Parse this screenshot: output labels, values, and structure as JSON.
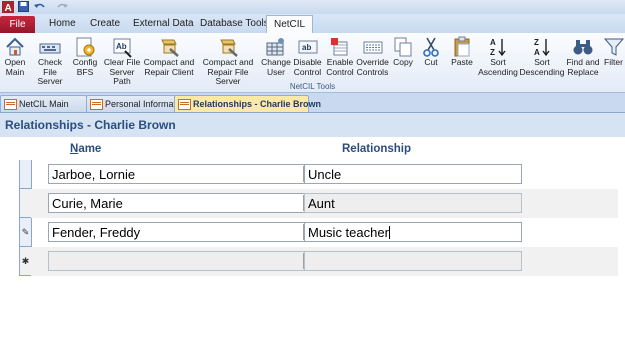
{
  "quick_access": {
    "app_icon": "access-icon",
    "save_icon": "save-icon",
    "undo_icon": "undo-icon",
    "redo_icon": "redo-icon"
  },
  "ribbon_tabs": [
    "File",
    "Home",
    "Create",
    "External Data",
    "Database Tools",
    "NetCIL"
  ],
  "active_ribbon_tab": "NetCIL",
  "ribbon": {
    "group_label": "NetCIL Tools",
    "buttons": [
      {
        "label": "Open\nMain",
        "icon": "house-icon"
      },
      {
        "label": "Check File\nServer",
        "icon": "keyboard-icon"
      },
      {
        "label": "Config\nBFS",
        "icon": "config-icon"
      },
      {
        "label": "Clear File\nServer Path",
        "icon": "ab-clear-icon"
      },
      {
        "label": "Compact and\nRepair Client",
        "icon": "compact-repair-icon"
      },
      {
        "label": "Compact and\nRepair File Server",
        "icon": "compact-repair-server-icon"
      },
      {
        "label": "Change\nUser",
        "icon": "user-grid-icon"
      },
      {
        "label": "Disable\nControl",
        "icon": "ab-textbox-icon"
      },
      {
        "label": "Enable\nControl",
        "icon": "enable-control-icon"
      },
      {
        "label": "Override\nControls",
        "icon": "override-controls-icon"
      },
      {
        "label": "Copy",
        "icon": "copy-icon"
      },
      {
        "label": "Cut",
        "icon": "scissors-icon"
      },
      {
        "label": "Paste",
        "icon": "clipboard-icon"
      },
      {
        "label": "Sort\nAscending",
        "icon": "sort-ascending-icon"
      },
      {
        "label": "Sort\nDescending",
        "icon": "sort-descending-icon"
      },
      {
        "label": "Find and\nReplace",
        "icon": "binoculars-icon"
      },
      {
        "label": "Filter",
        "icon": "filter-icon"
      }
    ]
  },
  "doc_tabs": [
    {
      "label": "NetCIL Main",
      "active": false
    },
    {
      "label": "Personal Information",
      "active": false
    },
    {
      "label": "Relationships - Charlie Brown",
      "active": true
    }
  ],
  "form": {
    "title": "Relationships - Charlie Brown",
    "col_name_first": "N",
    "col_name_rest": "ame",
    "col_relationship": "Relationship",
    "rows": [
      {
        "name": "Jarboe, Lornie",
        "relationship": "Uncle",
        "selector": ""
      },
      {
        "name": "Curie, Marie",
        "relationship": "Aunt",
        "selector": ""
      },
      {
        "name": "Fender, Freddy",
        "relationship": "Music teacher",
        "selector": "✎"
      },
      {
        "name": "",
        "relationship": "",
        "selector": "✱"
      }
    ]
  },
  "colors": {
    "accent": "#2b4e7e",
    "file_tab": "#b01e33",
    "active_doc_tab": "#fde9a7"
  }
}
